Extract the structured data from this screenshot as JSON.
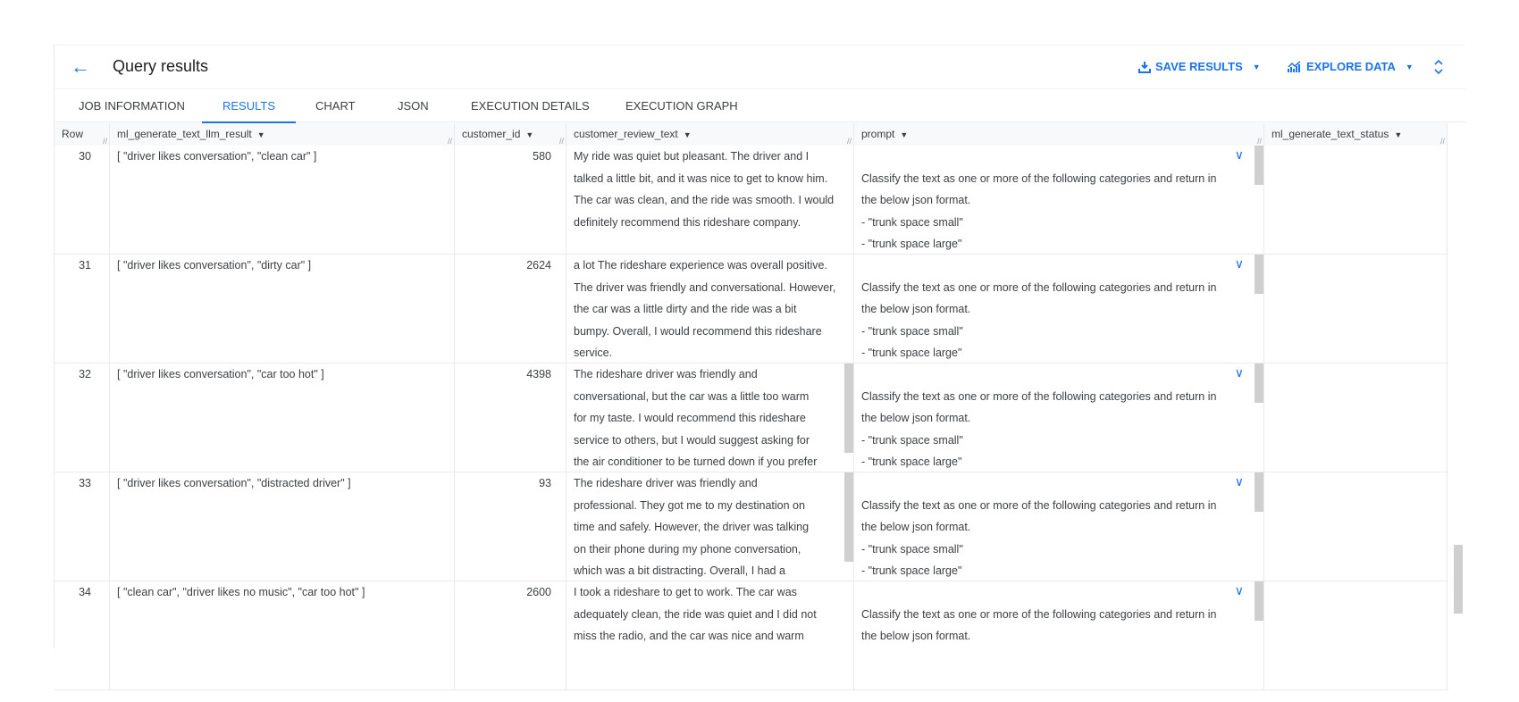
{
  "header": {
    "title": "Query results",
    "save_results": "SAVE RESULTS",
    "explore_data": "EXPLORE DATA"
  },
  "tabs": [
    {
      "label": "JOB INFORMATION"
    },
    {
      "label": "RESULTS",
      "active": true
    },
    {
      "label": "CHART"
    },
    {
      "label": "JSON"
    },
    {
      "label": "EXECUTION DETAILS"
    },
    {
      "label": "EXECUTION GRAPH"
    }
  ],
  "columns": [
    "Row",
    "ml_generate_text_llm_result",
    "customer_id",
    "customer_review_text",
    "prompt",
    "ml_generate_text_status"
  ],
  "rows": [
    {
      "row": "30",
      "result": "[ \"driver likes conversation\", \"clean car\" ]",
      "customer_id": "580",
      "review": [
        "My ride was quiet but pleasant. The driver and I",
        "talked a little bit, and it was nice to get to know him.",
        "The car was clean, and the ride was smooth. I would",
        "definitely recommend this rideshare company."
      ],
      "prompt": [
        "",
        "Classify the text as one or more of the following categories and return in",
        "the below json format.",
        "- \"trunk space small\"",
        "- \"trunk space large\""
      ],
      "status": "",
      "review_scroll": false
    },
    {
      "row": "31",
      "result": "[ \"driver likes conversation\", \"dirty car\" ]",
      "customer_id": "2624",
      "review": [
        "a lot The rideshare experience was overall positive.",
        "The driver was friendly and conversational. However,",
        "the car was a little dirty and the ride was a bit",
        "bumpy. Overall, I would recommend this rideshare",
        "service."
      ],
      "prompt": [
        "",
        "Classify the text as one or more of the following categories and return in",
        "the below json format.",
        "- \"trunk space small\"",
        "- \"trunk space large\""
      ],
      "status": "",
      "review_scroll": false
    },
    {
      "row": "32",
      "result": "[ \"driver likes conversation\", \"car too hot\" ]",
      "customer_id": "4398",
      "review": [
        "The rideshare driver was friendly and",
        "conversational, but the car was a little too warm",
        "for my taste. I would recommend this rideshare",
        "service to others, but I would suggest asking for",
        "the air conditioner to be turned down if you prefer"
      ],
      "prompt": [
        "",
        "Classify the text as one or more of the following categories and return in",
        "the below json format.",
        "- \"trunk space small\"",
        "- \"trunk space large\""
      ],
      "status": "",
      "review_scroll": true
    },
    {
      "row": "33",
      "result": "[ \"driver likes conversation\", \"distracted driver\" ]",
      "customer_id": "93",
      "review": [
        "The rideshare driver was friendly and",
        "professional. They got me to my destination on",
        "time and safely. However, the driver was talking",
        "on their phone during my phone conversation,",
        "which was a bit distracting. Overall, I had a"
      ],
      "prompt": [
        "",
        "Classify the text as one or more of the following categories and return in",
        "the below json format.",
        "- \"trunk space small\"",
        "- \"trunk space large\""
      ],
      "status": "",
      "review_scroll": true
    },
    {
      "row": "34",
      "result": "[ \"clean car\", \"driver likes no music\", \"car too hot\" ]",
      "customer_id": "2600",
      "review": [
        "I took a rideshare to get to work. The car was",
        "adequately clean, the ride was quiet and I did not",
        "miss the radio, and the car was nice and warm"
      ],
      "prompt": [
        "",
        "Classify the text as one or more of the following categories and return in",
        "the below json format."
      ],
      "status": "",
      "review_scroll": false
    }
  ],
  "colors": {
    "accent": "#1a73e8",
    "text": "#3c4043",
    "border": "#e8eaed",
    "header_bg": "#f8f9fa"
  }
}
